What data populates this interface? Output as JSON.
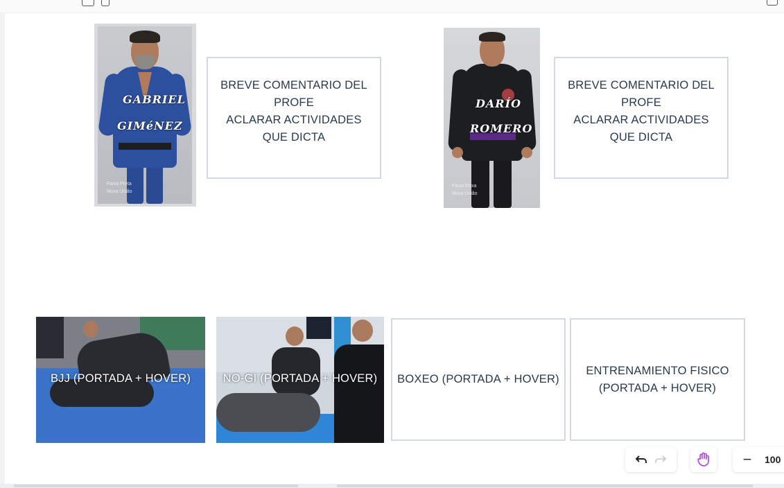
{
  "instructors": [
    {
      "name_line1": "GABRIEL",
      "name_line2": "GIMéNEZ",
      "rank_line1": "Faixa Preta",
      "rank_line2": "Nova União",
      "comment_lines": [
        "BREVE COMENTARIO DEL",
        "PROFE",
        "ACLARAR ACTIVIDADES",
        "QUE DICTA"
      ]
    },
    {
      "name_line1": "DARÍO",
      "name_line2": "ROMERO",
      "rank_line1": "Faixa Roxa",
      "rank_line2": "Nova União",
      "comment_lines": [
        "BREVE COMENTARIO DEL",
        "PROFE",
        "ACLARAR ACTIVIDADES",
        "QUE DICTA"
      ]
    }
  ],
  "activities": [
    {
      "label": "BJJ (PORTADA + HOVER)"
    },
    {
      "label": "NO-GI (PORTADA + HOVER)"
    },
    {
      "label": "BOXEO (PORTADA + HOVER)"
    },
    {
      "label_lines": [
        "ENTRENAMIENTO FISICO",
        "(PORTADA + HOVER)"
      ]
    }
  ],
  "toolbar": {
    "undo_icon": "undo-arrow-icon",
    "redo_icon": "redo-arrow-icon",
    "hand_icon": "hand-pan-icon",
    "zoom_out_icon": "minus-icon",
    "zoom_label": "100"
  },
  "colors": {
    "card_border": "#d2d9e2",
    "text": "#2a3a4d",
    "hand_icon": "#b44bd8",
    "mat_blue": "#3a6fc2"
  }
}
